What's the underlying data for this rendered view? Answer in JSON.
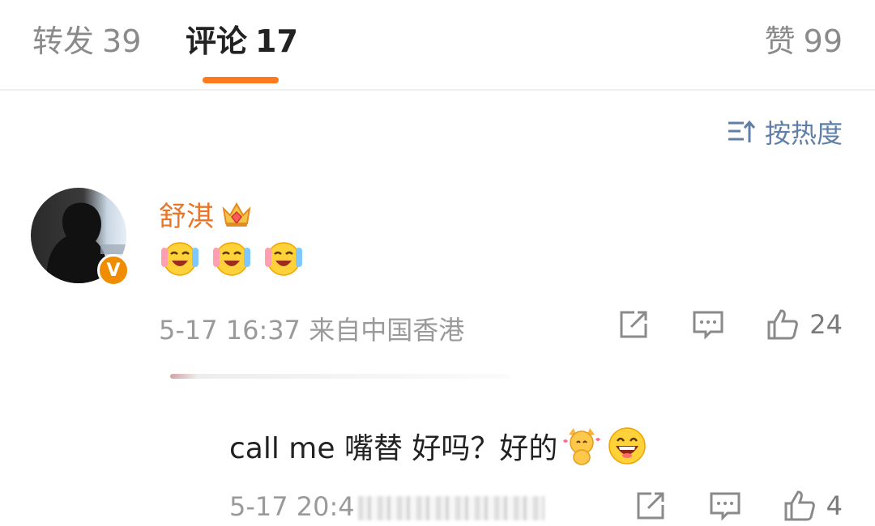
{
  "tabs": {
    "repost": {
      "label": "转发",
      "count": "39"
    },
    "comments": {
      "label": "评论",
      "count": "17"
    },
    "likes": {
      "label": "赞",
      "count": "99"
    },
    "active": "comments",
    "accent_color": "#ff7a1c"
  },
  "sort": {
    "label": "按热度",
    "icon": "sort-by-hot-icon"
  },
  "comments": [
    {
      "username": "舒淇",
      "username_color": "#e8752a",
      "badge_icon": "crown-icon",
      "verified_badge": "V",
      "content_emojis": [
        "laughing-tears-emoji",
        "laughing-tears-emoji",
        "laughing-tears-emoji"
      ],
      "timestamp": "5-17 16:37",
      "location": "来自中国香港",
      "like_count": "24"
    },
    {
      "content_text": "call me 嘴替 好吗？好的",
      "content_emojis": [
        "dancing-cat-emoji",
        "grinning-emoji"
      ],
      "timestamp_visible": "5-17 20:4",
      "like_count": "4"
    }
  ]
}
